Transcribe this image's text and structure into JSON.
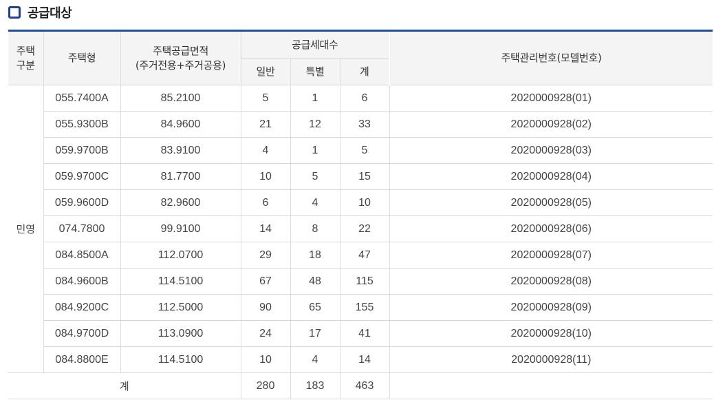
{
  "section": {
    "title": "공급대상"
  },
  "header": {
    "category": [
      "주택",
      "구분"
    ],
    "type": "주택형",
    "area": [
      "주택공급면적",
      "(주거전용+주거공용)"
    ],
    "units": "공급세대수",
    "general": "일반",
    "special": "특별",
    "total": "계",
    "management_no": "주택관리번호(모델번호)"
  },
  "category_value": "민영",
  "rows": [
    {
      "type": "055.7400A",
      "area": "85.2100",
      "general": "5",
      "special": "1",
      "total": "6",
      "no": "2020000928(01)"
    },
    {
      "type": "055.9300B",
      "area": "84.9600",
      "general": "21",
      "special": "12",
      "total": "33",
      "no": "2020000928(02)"
    },
    {
      "type": "059.9700B",
      "area": "83.9100",
      "general": "4",
      "special": "1",
      "total": "5",
      "no": "2020000928(03)"
    },
    {
      "type": "059.9700C",
      "area": "81.7700",
      "general": "10",
      "special": "5",
      "total": "15",
      "no": "2020000928(04)"
    },
    {
      "type": "059.9600D",
      "area": "82.9600",
      "general": "6",
      "special": "4",
      "total": "10",
      "no": "2020000928(05)"
    },
    {
      "type": "074.7800",
      "area": "99.9100",
      "general": "14",
      "special": "8",
      "total": "22",
      "no": "2020000928(06)"
    },
    {
      "type": "084.8500A",
      "area": "112.0700",
      "general": "29",
      "special": "18",
      "total": "47",
      "no": "2020000928(07)"
    },
    {
      "type": "084.9600B",
      "area": "114.5100",
      "general": "67",
      "special": "48",
      "total": "115",
      "no": "2020000928(08)"
    },
    {
      "type": "084.9200C",
      "area": "112.5000",
      "general": "90",
      "special": "65",
      "total": "155",
      "no": "2020000928(09)"
    },
    {
      "type": "084.9700D",
      "area": "113.0900",
      "general": "24",
      "special": "17",
      "total": "41",
      "no": "2020000928(10)"
    },
    {
      "type": "084.8800E",
      "area": "114.5100",
      "general": "10",
      "special": "4",
      "total": "14",
      "no": "2020000928(11)"
    }
  ],
  "summary": {
    "label": "계",
    "general": "280",
    "special": "183",
    "total": "463",
    "no": ""
  }
}
